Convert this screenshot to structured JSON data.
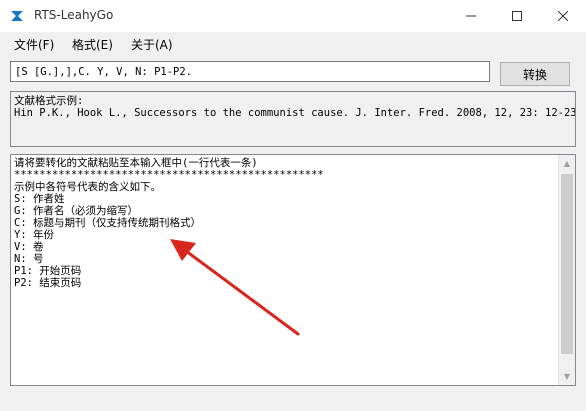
{
  "window": {
    "title": "RTS-LeahyGo",
    "icon": "app-icon"
  },
  "menu": [
    {
      "label": "文件(F)"
    },
    {
      "label": "格式(E)"
    },
    {
      "label": "关于(A)"
    }
  ],
  "format_input": {
    "value": "[S [G.],],C. Y, V, N: P1-P2."
  },
  "convert_button": {
    "label": "转换"
  },
  "example": {
    "label": "文献格式示例:",
    "text": "Hin P.K., Hook L., Successors to the communist cause. J. Inter. Fred. 2008, 12, 23: 12-23."
  },
  "main_text": [
    "请将要转化的文献粘贴至本输入框中(一行代表一条)",
    "*************************************************",
    "示例中各符号代表的含义如下。",
    "S: 作者姓",
    "G: 作者名（必须为缩写）",
    "C: 标题与期刊（仅支持传统期刊格式）",
    "Y: 年份",
    "V: 卷",
    "N: 号",
    "P1: 开始页码",
    "P2: 结束页码"
  ],
  "colors": {
    "accent_arrow": "#d9261c",
    "icon_blue": "#1a73c8"
  }
}
